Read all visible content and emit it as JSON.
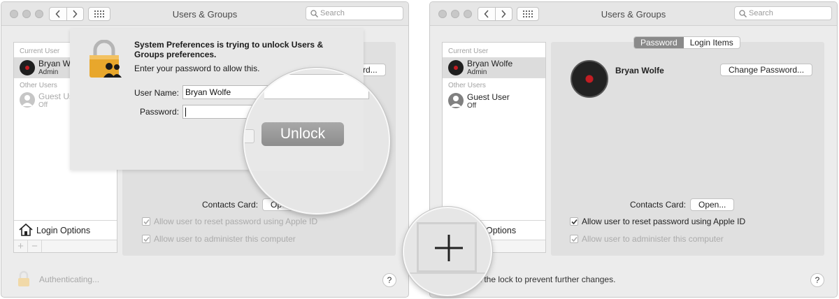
{
  "left_window": {
    "title": "Users & Groups",
    "search_placeholder": "Search",
    "sidebar": {
      "current_user_label": "Current User",
      "current_user_name": "Bryan Wolfe",
      "current_user_role": "Admin",
      "other_users_label": "Other Users",
      "guest_name": "Guest User",
      "guest_status": "Off",
      "login_options": "Login Options",
      "add_symbol": "+",
      "remove_symbol": "−"
    },
    "background_button": "Password...",
    "contacts_card_label": "Contacts Card:",
    "contacts_open_button": "Open...",
    "checkbox_reset": "Allow user to reset password using Apple ID",
    "checkbox_admin": "Allow user to administer this computer",
    "status": "Authenticating...",
    "help": "?",
    "dialog": {
      "title": "System Preferences is trying to unlock Users & Groups preferences.",
      "message": "Enter your password to allow this.",
      "username_label": "User Name:",
      "username_value": "Bryan Wolfe",
      "password_label": "Password:",
      "unlock_button": "Unlock"
    }
  },
  "right_window": {
    "title": "Users & Groups",
    "search_placeholder": "Search",
    "tabs": [
      {
        "label": "Password",
        "selected": true
      },
      {
        "label": "Login Items",
        "selected": false
      }
    ],
    "sidebar": {
      "current_user_label": "Current User",
      "current_user_name": "Bryan Wolfe",
      "current_user_role": "Admin",
      "other_users_label": "Other Users",
      "guest_name": "Guest User",
      "guest_status": "Off",
      "login_options": "Options"
    },
    "user_name": "Bryan Wolfe",
    "change_password_button": "Change Password...",
    "contacts_card_label": "Contacts Card:",
    "contacts_open_button": "Open...",
    "checkbox_reset": "Allow user to reset password using Apple ID",
    "checkbox_reset_checked": true,
    "checkbox_admin": "Allow user to administer this computer",
    "checkbox_admin_checked": true,
    "status": "ck the lock to prevent further changes.",
    "help": "?"
  },
  "zoom_plus_symbol": "+",
  "colors": {
    "window_bg": "#ececec",
    "selected_row": "#dcdcdc",
    "unlock_button": "#9a9a9a",
    "lock_gold": "#e8a72c",
    "avatar_red": "#c31d23"
  },
  "icons": [
    "back-arrow-icon",
    "forward-arrow-icon",
    "grid-icon",
    "search-icon",
    "lock-icon",
    "house-icon",
    "guest-user-icon",
    "checkmark-icon",
    "plus-icon"
  ]
}
